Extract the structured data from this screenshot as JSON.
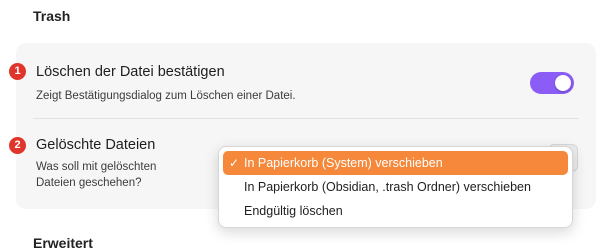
{
  "section": {
    "title": "Trash"
  },
  "colors": {
    "accent": "#8b5cf6",
    "selection": "#f5883a",
    "badge": "#e0352b"
  },
  "settings": [
    {
      "badge": "1",
      "title": "Löschen der Datei bestätigen",
      "description": "Zeigt Bestätigungsdialog zum Löschen einer Datei.",
      "toggle_on": true
    },
    {
      "badge": "2",
      "title": "Gelöschte Dateien",
      "description_line1": "Was soll mit gelöschten",
      "description_line2": "Dateien geschehen?"
    }
  ],
  "dropdown": {
    "check_icon": "✓",
    "options": [
      {
        "label": "In Papierkorb (System) verschieben",
        "selected": true
      },
      {
        "label": "In Papierkorb (Obsidian, .trash Ordner) verschieben",
        "selected": false
      },
      {
        "label": "Endgültig löschen",
        "selected": false
      }
    ]
  },
  "next_section": {
    "title": "Erweitert"
  }
}
